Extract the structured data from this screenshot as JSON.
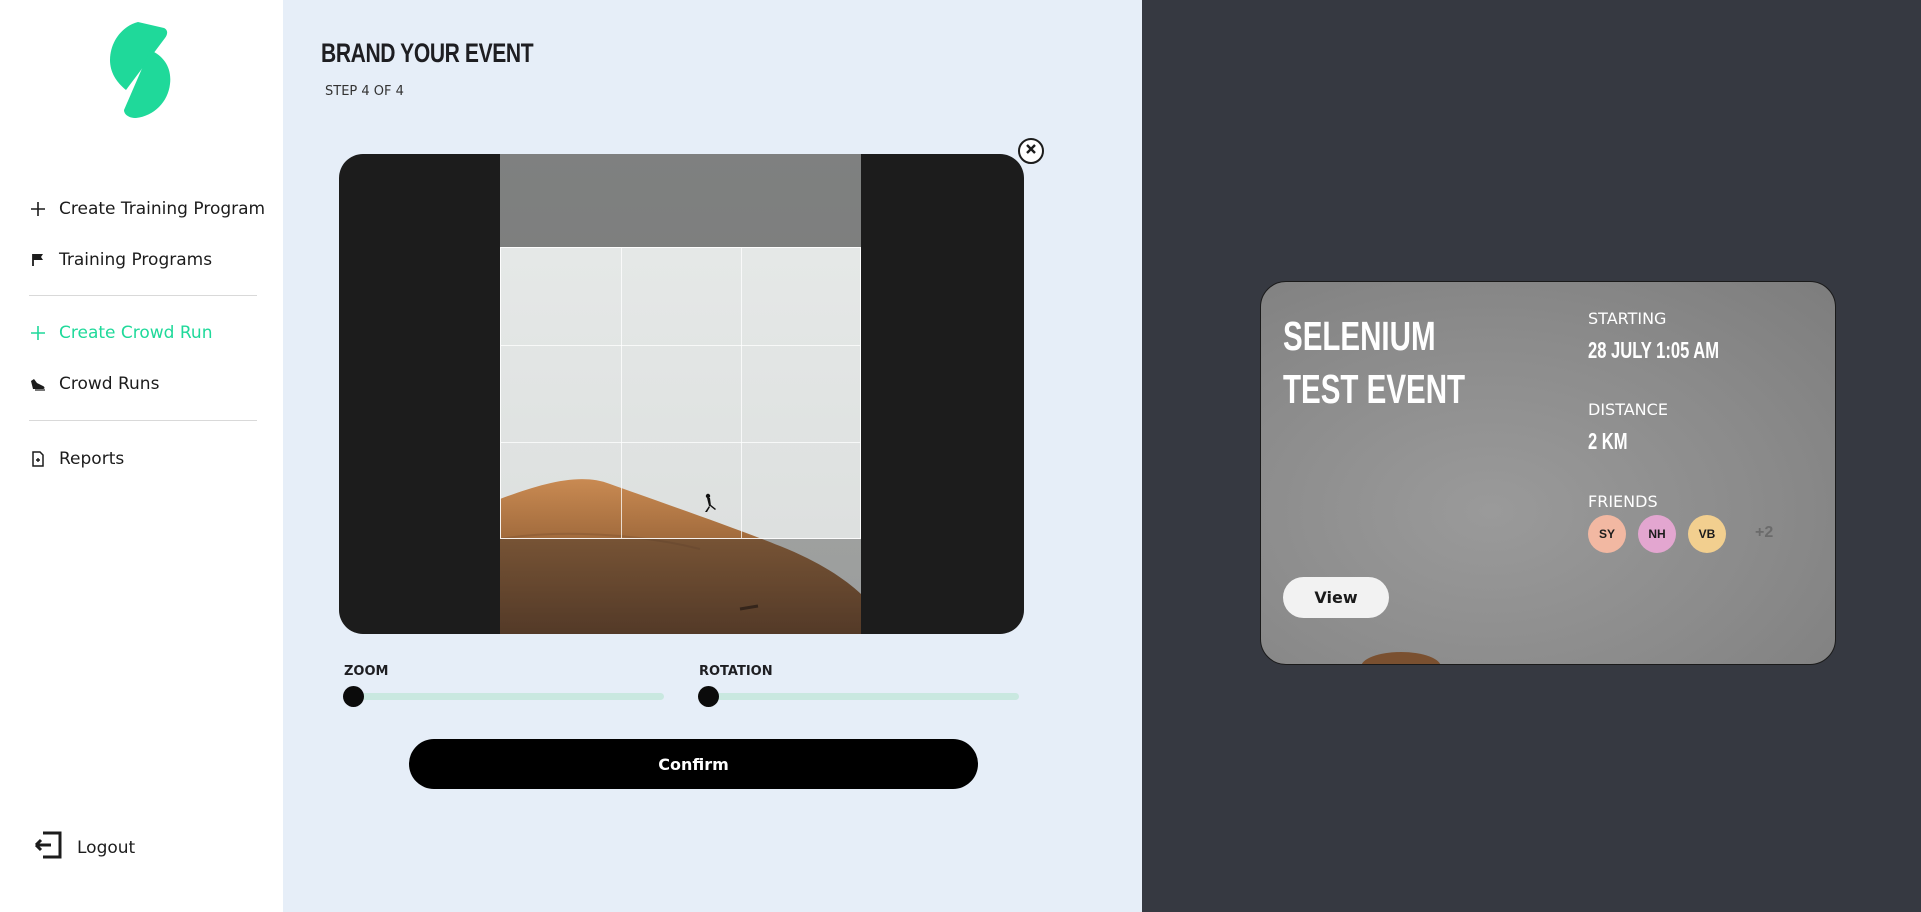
{
  "sidebar": {
    "items": [
      {
        "label": "Create Training Program",
        "icon": "plus-icon"
      },
      {
        "label": "Training Programs",
        "icon": "flag-icon"
      },
      {
        "label": "Create Crowd Run",
        "icon": "plus-icon",
        "active": true
      },
      {
        "label": "Crowd Runs",
        "icon": "running-shoe-icon"
      },
      {
        "label": "Reports",
        "icon": "report-document-icon"
      }
    ],
    "logout_label": "Logout",
    "accent_color": "#1fd99a"
  },
  "main": {
    "title": "BRAND YOUR EVENT",
    "step": "STEP 4 OF 4",
    "cropper": {
      "zoom_label": "ZOOM",
      "zoom_value": 0,
      "rotation_label": "ROTATION",
      "rotation_value": 0
    },
    "confirm_label": "Confirm"
  },
  "preview": {
    "event_title": "SELENIUM TEST EVENT",
    "starting_label": "STARTING",
    "starting_value": "28 JULY 1:05 AM",
    "distance_label": "DISTANCE",
    "distance_value": "2 KM",
    "friends_label": "FRIENDS",
    "friends": [
      {
        "initials": "SY",
        "color": "#f2b8a2"
      },
      {
        "initials": "NH",
        "color": "#e3a6d0"
      },
      {
        "initials": "VB",
        "color": "#f2cf8f"
      }
    ],
    "more_friends": "+2",
    "view_label": "View"
  }
}
